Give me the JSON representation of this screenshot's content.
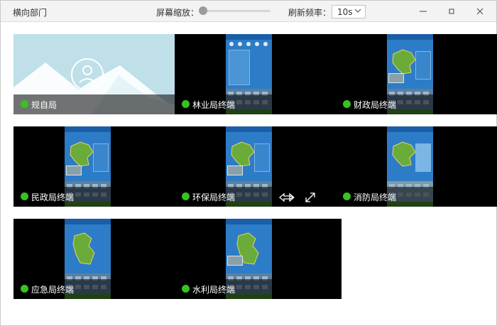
{
  "titlebar": {
    "title": "横向部门",
    "zoom_label": "屏幕缩放：",
    "zoom_level": 0,
    "refresh_label": "刷新频率：",
    "refresh_value": "10s"
  },
  "window_controls": [
    "minimize-icon",
    "maximize-icon",
    "close-icon"
  ],
  "status_color": "#37c31f",
  "tiles": [
    {
      "name": "规自局",
      "placeholder": true
    },
    {
      "name": "林业局终端"
    },
    {
      "name": "财政局终端"
    },
    {
      "name": "民政局终端"
    },
    {
      "name": "环保局终端",
      "hover_controls": [
        "swap-icon",
        "fullscreen-icon"
      ]
    },
    {
      "name": "消防局终端"
    },
    {
      "name": "应急局终端"
    },
    {
      "name": "水利局终端"
    }
  ]
}
